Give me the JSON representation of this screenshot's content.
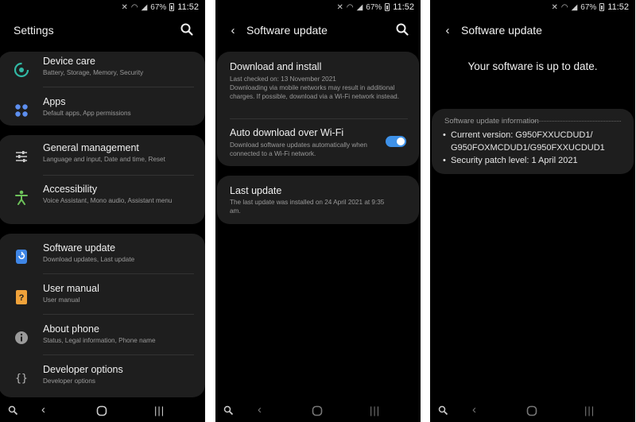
{
  "status": {
    "battery": "67%",
    "time": "11:52"
  },
  "screen1": {
    "title": "Settings",
    "items": [
      {
        "title": "Device care",
        "subtitle": "Battery, Storage, Memory, Security"
      },
      {
        "title": "Apps",
        "subtitle": "Default apps, App permissions"
      },
      {
        "title": "General management",
        "subtitle": "Language and input, Date and time, Reset"
      },
      {
        "title": "Accessibility",
        "subtitle": "Voice Assistant, Mono audio, Assistant menu"
      },
      {
        "title": "Software update",
        "subtitle": "Download updates, Last update"
      },
      {
        "title": "User manual",
        "subtitle": "User manual"
      },
      {
        "title": "About phone",
        "subtitle": "Status, Legal information, Phone name"
      },
      {
        "title": "Developer options",
        "subtitle": "Developer options"
      }
    ]
  },
  "screen2": {
    "title": "Software update",
    "download": {
      "title": "Download and install",
      "line1": "Last checked on: 13 November 2021",
      "line2": "Downloading via mobile networks may result in additional charges. If possible, download via a Wi-Fi network instead."
    },
    "auto": {
      "title": "Auto download over Wi-Fi",
      "subtitle": "Download software updates automatically when connected to a Wi-Fi network.",
      "enabled": true
    },
    "last": {
      "title": "Last update",
      "subtitle": "The last update was installed on 24 April 2021 at 9:35 am."
    }
  },
  "screen3": {
    "title": "Software update",
    "message": "Your software is up to date.",
    "info_title": "Software update information",
    "current_version_a": "Current version: G950FXXUCDUD1/",
    "current_version_b": "G950FOXMCDUD1/G950FXXUCDUD1",
    "security_patch": "Security patch level: 1 April 2021"
  },
  "colors": {
    "accent": "#3e91e8",
    "card": "#1e1e1e",
    "background": "#000000"
  },
  "icons": [
    "device-care-icon",
    "apps-icon",
    "general-management-icon",
    "accessibility-icon",
    "software-update-icon",
    "user-manual-icon",
    "about-phone-icon",
    "developer-options-icon",
    "search-icon",
    "back-icon",
    "zoom-icon",
    "home-icon",
    "recents-icon"
  ]
}
